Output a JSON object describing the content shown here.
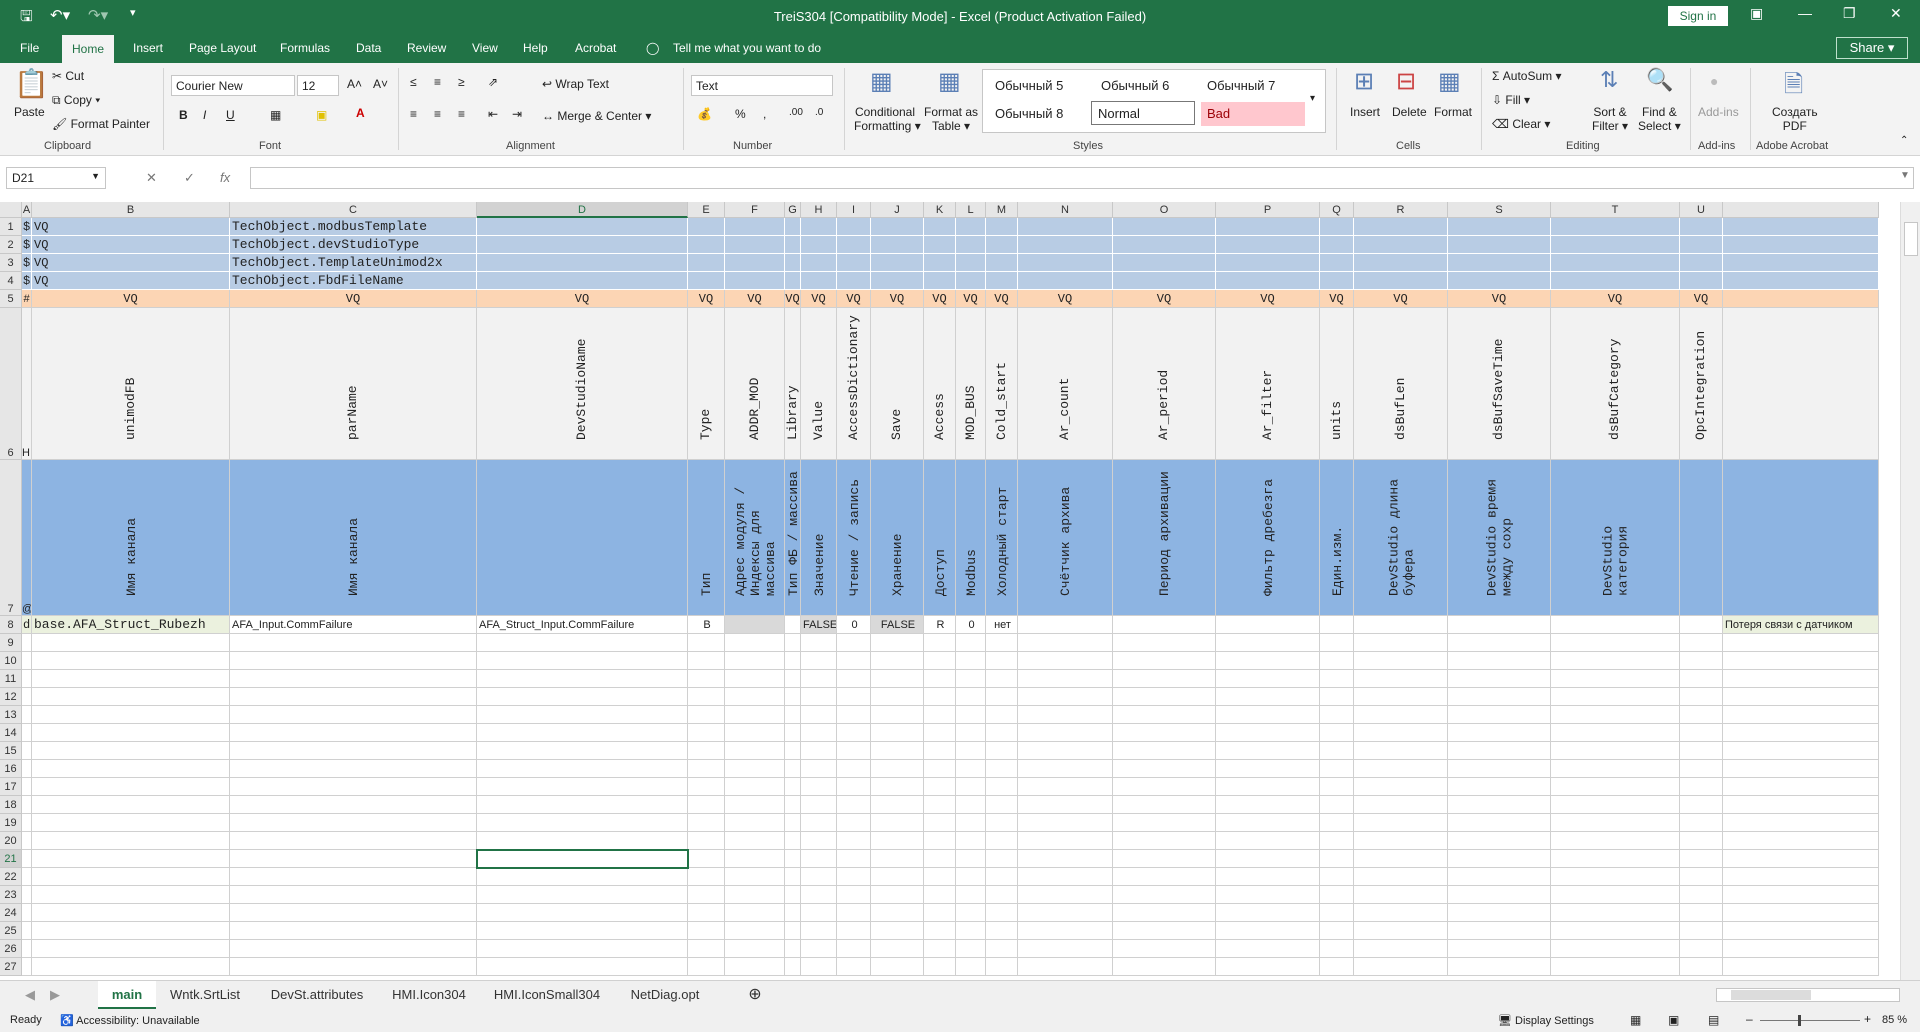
{
  "title": "TreiS304 [Compatibility Mode] - Excel (Product Activation Failed)",
  "signin": "Sign in",
  "share": "Share",
  "menu": [
    "File",
    "Home",
    "Insert",
    "Page Layout",
    "Formulas",
    "Data",
    "Review",
    "View",
    "Help",
    "Acrobat"
  ],
  "tellme": "Tell me what you want to do",
  "ribbon": {
    "paste": "Paste",
    "cut": "Cut",
    "copy": "Copy",
    "format_painter": "Format Painter",
    "font_name": "Courier New",
    "font_size": "12",
    "wrap_text": "Wrap Text",
    "merge_center": "Merge & Center",
    "number_format": "Text",
    "conditional": [
      "Conditional",
      "Formatting"
    ],
    "format_table": [
      "Format as",
      "Table"
    ],
    "styles": [
      "Обычный 5",
      "Обычный 6",
      "Обычный 7",
      "Обычный 8",
      "Normal",
      "Bad"
    ],
    "insert": "Insert",
    "delete": "Delete",
    "format": "Format",
    "autosum": "AutoSum",
    "fill": "Fill",
    "clear": "Clear",
    "sort": [
      "Sort &",
      "Filter"
    ],
    "find": [
      "Find &",
      "Select"
    ],
    "addins": "Add-ins",
    "create_pdf": [
      "Создать",
      "PDF"
    ],
    "groups": [
      "Clipboard",
      "Font",
      "Alignment",
      "Number",
      "Styles",
      "Cells",
      "Editing",
      "Add-ins",
      "Adobe Acrobat"
    ]
  },
  "name_box": "D21",
  "columns": [
    "A",
    "B",
    "C",
    "D",
    "E",
    "F",
    "G",
    "H",
    "I",
    "J",
    "K",
    "L",
    "M",
    "N",
    "O",
    "P",
    "Q",
    "R",
    "S",
    "T",
    "U"
  ],
  "rows_top": {
    "r1": [
      "$",
      "VQ",
      "TechObject.modbusTemplate"
    ],
    "r2": [
      "$",
      "VQ",
      "TechObject.devStudioType"
    ],
    "r3": [
      "$",
      "VQ",
      "TechObject.TemplateUnimod2x"
    ],
    "r4": [
      "$",
      "VQ",
      "TechObject.FbdFileName"
    ],
    "r5_a": "#",
    "r5_vq": "VQ",
    "r6_a": "H",
    "r7_a": "@",
    "r8_a": "d"
  },
  "row6": [
    "unimodFB",
    "parName",
    "DevStudioName",
    "Type",
    "ADDR_MOD",
    "Library",
    "Value",
    "AccessDictionary",
    "Save",
    "Access",
    "MOD_BUS",
    "Cold_start",
    "Ar_count",
    "Ar_period",
    "Ar_filter",
    "units",
    "dsBufLen",
    "dsBufSaveTime",
    "dsBufCategory",
    "OpcIntegration",
    ""
  ],
  "row7": [
    [
      "Имя канала"
    ],
    [
      "Имя канала"
    ],
    [
      ""
    ],
    [
      "Тип"
    ],
    [
      "Адрес модуля /",
      "Индексы для",
      "массива"
    ],
    [
      "Тип ФБ / массива"
    ],
    [
      "Значение"
    ],
    [
      "Чтение / запись"
    ],
    [
      "Хранение"
    ],
    [
      "Доступ"
    ],
    [
      "Modbus"
    ],
    [
      "Холодный старт"
    ],
    [
      "Счётчик архива"
    ],
    [
      "Период архивации"
    ],
    [
      "Фильтр дребезга"
    ],
    [
      "Един.изм."
    ],
    [
      "DevStudio длина",
      "буфера"
    ],
    [
      "DevStudio время",
      "между сохр"
    ],
    [
      "DevStudio",
      "категория"
    ],
    [
      ""
    ],
    [
      ""
    ]
  ],
  "row8": [
    "base.AFA_Struct_Rubezh",
    "AFA_Input.CommFailure",
    "AFA_Struct_Input.CommFailure",
    "B",
    "",
    "",
    "FALSE",
    "0",
    "FALSE",
    "R",
    "0",
    "нет",
    "",
    "",
    "",
    "",
    "",
    "",
    "",
    "",
    "Потеря связи с датчиком"
  ],
  "row_numbers": [
    "1",
    "2",
    "3",
    "4",
    "5",
    "6",
    "7",
    "8",
    "9",
    "10",
    "11",
    "12",
    "13",
    "14",
    "15",
    "16",
    "17",
    "18",
    "19",
    "20",
    "21",
    "22",
    "23",
    "24",
    "25",
    "26",
    "27"
  ],
  "sheets": [
    "main",
    "Wntk.SrtList",
    "DevSt.attributes",
    "HMI.Icon304",
    "HMI.IconSmall304",
    "NetDiag.opt"
  ],
  "status": {
    "ready": "Ready",
    "accessibility": "Accessibility: Unavailable",
    "display": "Display Settings",
    "zoom": "85 %"
  }
}
